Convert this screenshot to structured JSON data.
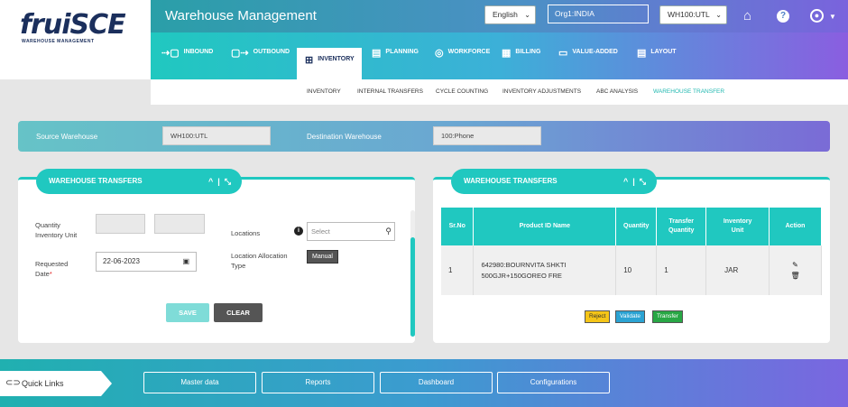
{
  "brand": {
    "name_main": "frui",
    "name_accent": "SCE",
    "tagline": "WAREHOUSE MANAGEMENT"
  },
  "header": {
    "title": "Warehouse Management",
    "language": "English",
    "org": "Org1:INDIA",
    "warehouse": "WH100:UTL",
    "icons": [
      "home-icon",
      "help-icon",
      "user-icon"
    ]
  },
  "nav": [
    {
      "label": "INBOUND",
      "icon": "inbound-icon"
    },
    {
      "label": "OUTBOUND",
      "icon": "outbound-icon"
    },
    {
      "label": "INVENTORY",
      "icon": "inventory-icon"
    },
    {
      "label": "PLANNING",
      "icon": "planning-icon"
    },
    {
      "label": "WORKFORCE",
      "icon": "workforce-icon"
    },
    {
      "label": "BILLING",
      "icon": "billing-icon"
    },
    {
      "label": "VALUE-ADDED",
      "icon": "value-added-icon"
    },
    {
      "label": "LAYOUT",
      "icon": "layout-icon"
    }
  ],
  "active_nav": "INVENTORY",
  "subnav": [
    "INVENTORY",
    "INTERNAL TRANSFERS",
    "CYCLE COUNTING",
    "INVENTORY ADJUSTMENTS",
    "ABC ANALYSIS",
    "WAREHOUSE TRANSFER"
  ],
  "active_subnav": "WAREHOUSE TRANSFER",
  "transfer_bar": {
    "source_label": "Source Warehouse",
    "source_value": "WH100:UTL",
    "dest_label": "Destination Warehouse",
    "dest_value": "100:Phone"
  },
  "left_panel": {
    "title": "WAREHOUSE TRANSFERS",
    "qty_label_1": "Quantity",
    "qty_label_2": "Inventory Unit",
    "date_label_1": "Requested",
    "date_label_2": "Date",
    "date_required": "*",
    "date_value": "22-06-2023",
    "locations_label": "Locations",
    "locations_placeholder": "Select",
    "alloc_label_1": "Location Allocation",
    "alloc_label_2": "Type",
    "alloc_value": "Manual",
    "save": "SAVE",
    "clear": "CLEAR"
  },
  "right_panel": {
    "title": "WAREHOUSE TRANSFERS",
    "columns": {
      "srno": "Sr.No",
      "product": "Product ID Name",
      "quantity": "Quantity",
      "transfer_1": "Transfer",
      "transfer_2": "Quantity",
      "unit_1": "Inventory",
      "unit_2": "Unit",
      "action": "Action"
    },
    "rows": [
      {
        "srno": "1",
        "product_1": "642980:BOURNVITA SHKTI",
        "product_2": "500GJR+150GOREO FRE",
        "quantity": "10",
        "transfer_qty": "1",
        "unit": "JAR"
      }
    ],
    "reject": "Reject",
    "validate": "Validate",
    "transfer": "Transfer"
  },
  "footer": {
    "quick_links": "Quick Links",
    "links": [
      "Master data",
      "Reports",
      "Dashboard",
      "Configurations"
    ]
  },
  "colors": {
    "teal": "#20c8c0",
    "navy": "#1b2f5c",
    "purple": "#7a63dd"
  }
}
